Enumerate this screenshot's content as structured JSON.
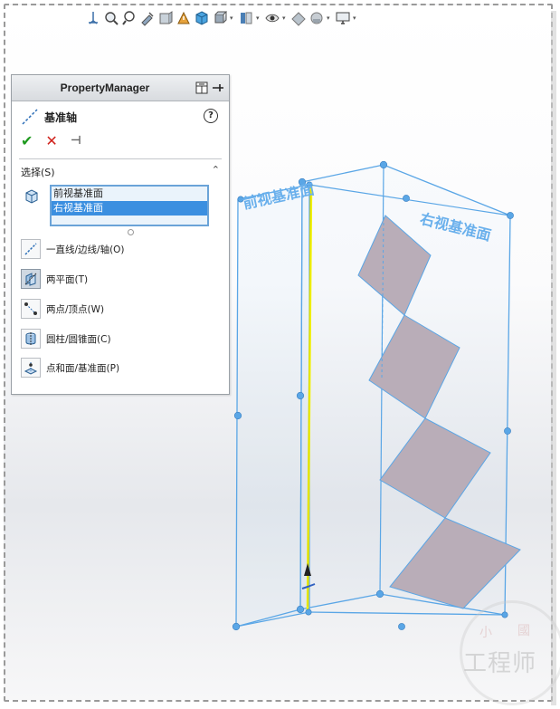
{
  "panel": {
    "title": "PropertyManager",
    "feature_name": "基准轴",
    "help_glyph": "?",
    "ok_glyph": "✔",
    "cancel_glyph": "✕",
    "pin_glyph": "⊣",
    "section_title": "选择(S)",
    "collapse_glyph": "⌃",
    "selections": [
      "前视基准面",
      "右视基准面"
    ],
    "options": [
      {
        "label": "一直线/边线/轴(O)",
        "icon": "line-axis-icon"
      },
      {
        "label": "两平面(T)",
        "icon": "two-planes-icon",
        "active": true
      },
      {
        "label": "两点/顶点(W)",
        "icon": "two-points-icon"
      },
      {
        "label": "圆柱/圆锥面(C)",
        "icon": "cylinder-icon"
      },
      {
        "label": "点和面/基准面(P)",
        "icon": "point-plane-icon"
      }
    ]
  },
  "viewport": {
    "front_plane_label": "前视基准面",
    "right_plane_label": "右视基准面",
    "plane_color": "#5aa6e6",
    "axis_color": "#f2f200",
    "face_color": "#b9adb8"
  },
  "watermark": {
    "text": "工程师",
    "top_left": "小",
    "top_right": "國"
  }
}
